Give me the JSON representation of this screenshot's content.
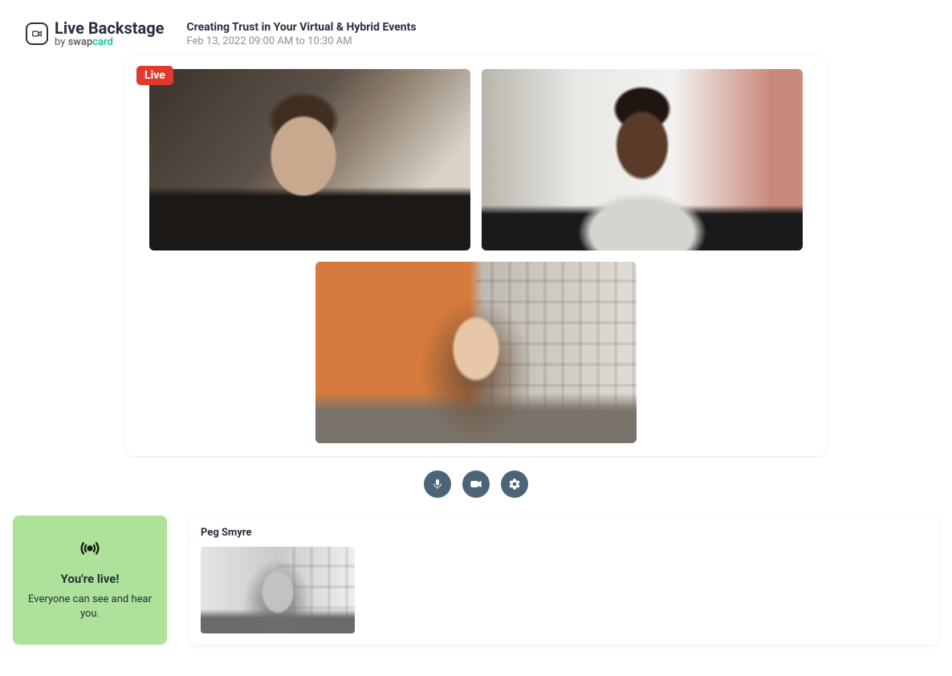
{
  "header": {
    "logo_title": "Live Backstage",
    "logo_by": "by ",
    "logo_brand_1": "swap",
    "logo_brand_2": "card",
    "event_title": "Creating Trust in Your Virtual & Hybrid Events",
    "event_time": "Feb 13, 2022 09:00 AM to 10:30 AM"
  },
  "stage": {
    "live_badge": "Live"
  },
  "controls": {
    "mic": "microphone",
    "camera": "camera",
    "settings": "settings"
  },
  "live_status": {
    "title": "You're live!",
    "subtitle": "Everyone can see and hear you."
  },
  "backstage": {
    "participant_name": "Peg Smyre"
  }
}
